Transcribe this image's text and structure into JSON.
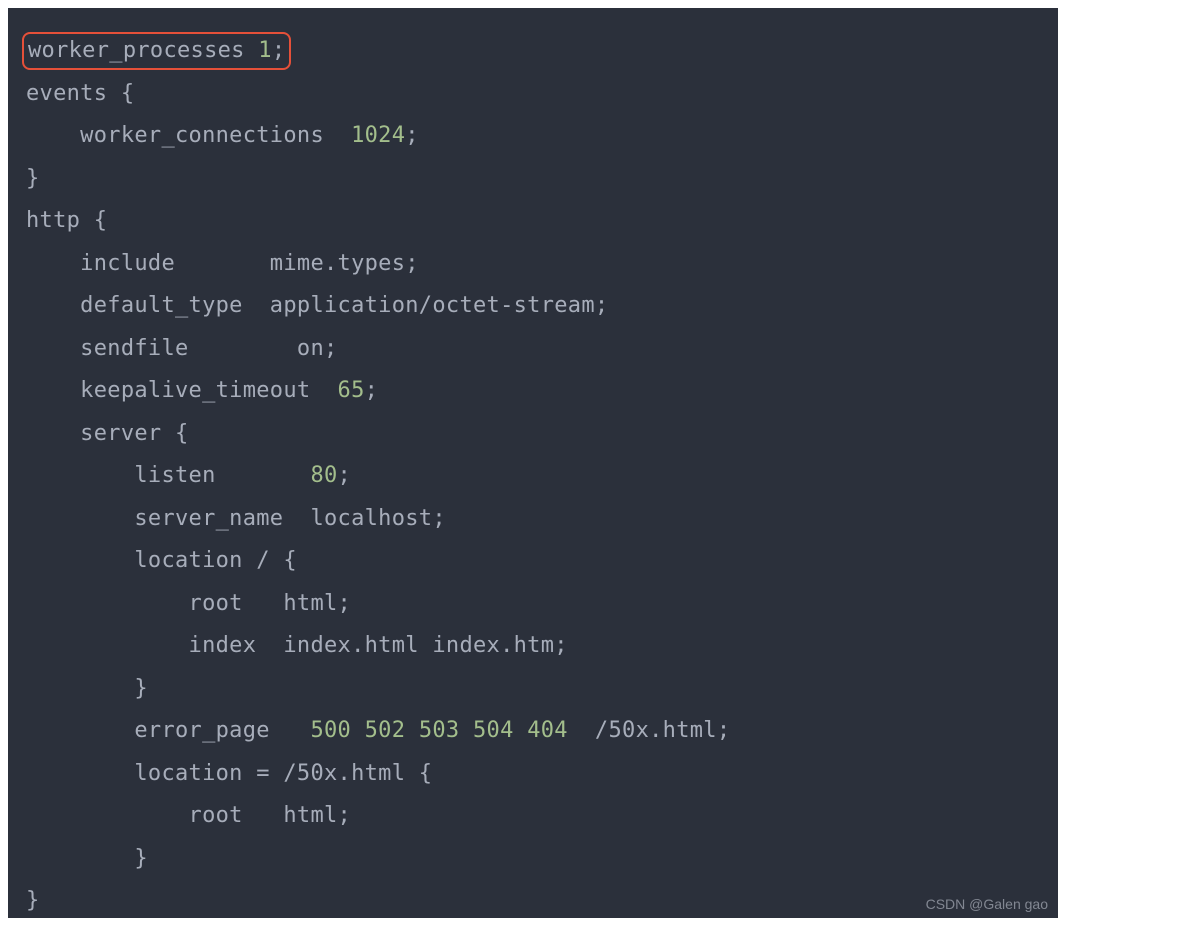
{
  "highlight": {
    "directive": "worker_processes",
    "spacing": "  ",
    "value": "1",
    "terminator": ";"
  },
  "code": {
    "lines": [
      {
        "segments": [
          {
            "t": "",
            "cls": ""
          }
        ]
      },
      {
        "segments": [
          {
            "t": "events {",
            "cls": ""
          }
        ]
      },
      {
        "segments": [
          {
            "t": "    worker_connections  ",
            "cls": ""
          },
          {
            "t": "1024",
            "cls": "num"
          },
          {
            "t": ";",
            "cls": ""
          }
        ]
      },
      {
        "segments": [
          {
            "t": "}",
            "cls": ""
          }
        ]
      },
      {
        "segments": [
          {
            "t": "http {",
            "cls": ""
          }
        ]
      },
      {
        "segments": [
          {
            "t": "    include       mime.types;",
            "cls": ""
          }
        ]
      },
      {
        "segments": [
          {
            "t": "    default_type  application/octet-stream;",
            "cls": ""
          }
        ]
      },
      {
        "segments": [
          {
            "t": "    sendfile        on;",
            "cls": ""
          }
        ]
      },
      {
        "segments": [
          {
            "t": "    keepalive_timeout  ",
            "cls": ""
          },
          {
            "t": "65",
            "cls": "num"
          },
          {
            "t": ";",
            "cls": ""
          }
        ]
      },
      {
        "segments": [
          {
            "t": "    server {",
            "cls": ""
          }
        ]
      },
      {
        "segments": [
          {
            "t": "        listen       ",
            "cls": ""
          },
          {
            "t": "80",
            "cls": "num"
          },
          {
            "t": ";",
            "cls": ""
          }
        ]
      },
      {
        "segments": [
          {
            "t": "        server_name  localhost;",
            "cls": ""
          }
        ]
      },
      {
        "segments": [
          {
            "t": "        location / {",
            "cls": ""
          }
        ]
      },
      {
        "segments": [
          {
            "t": "            root   html;",
            "cls": ""
          }
        ]
      },
      {
        "segments": [
          {
            "t": "            index  index.html index.htm;",
            "cls": ""
          }
        ]
      },
      {
        "segments": [
          {
            "t": "        }",
            "cls": ""
          }
        ]
      },
      {
        "segments": [
          {
            "t": "        error_page   ",
            "cls": ""
          },
          {
            "t": "500",
            "cls": "num"
          },
          {
            "t": " ",
            "cls": ""
          },
          {
            "t": "502",
            "cls": "num"
          },
          {
            "t": " ",
            "cls": ""
          },
          {
            "t": "503",
            "cls": "num"
          },
          {
            "t": " ",
            "cls": ""
          },
          {
            "t": "504",
            "cls": "num"
          },
          {
            "t": " ",
            "cls": ""
          },
          {
            "t": "404",
            "cls": "num"
          },
          {
            "t": "  /50x.html;",
            "cls": ""
          }
        ]
      },
      {
        "segments": [
          {
            "t": "        location = /50x.html {",
            "cls": ""
          }
        ]
      },
      {
        "segments": [
          {
            "t": "            root   html;",
            "cls": ""
          }
        ]
      },
      {
        "segments": [
          {
            "t": "        }",
            "cls": ""
          }
        ]
      },
      {
        "segments": [
          {
            "t": "}",
            "cls": ""
          }
        ]
      }
    ]
  },
  "watermark": "CSDN @Galen gao"
}
